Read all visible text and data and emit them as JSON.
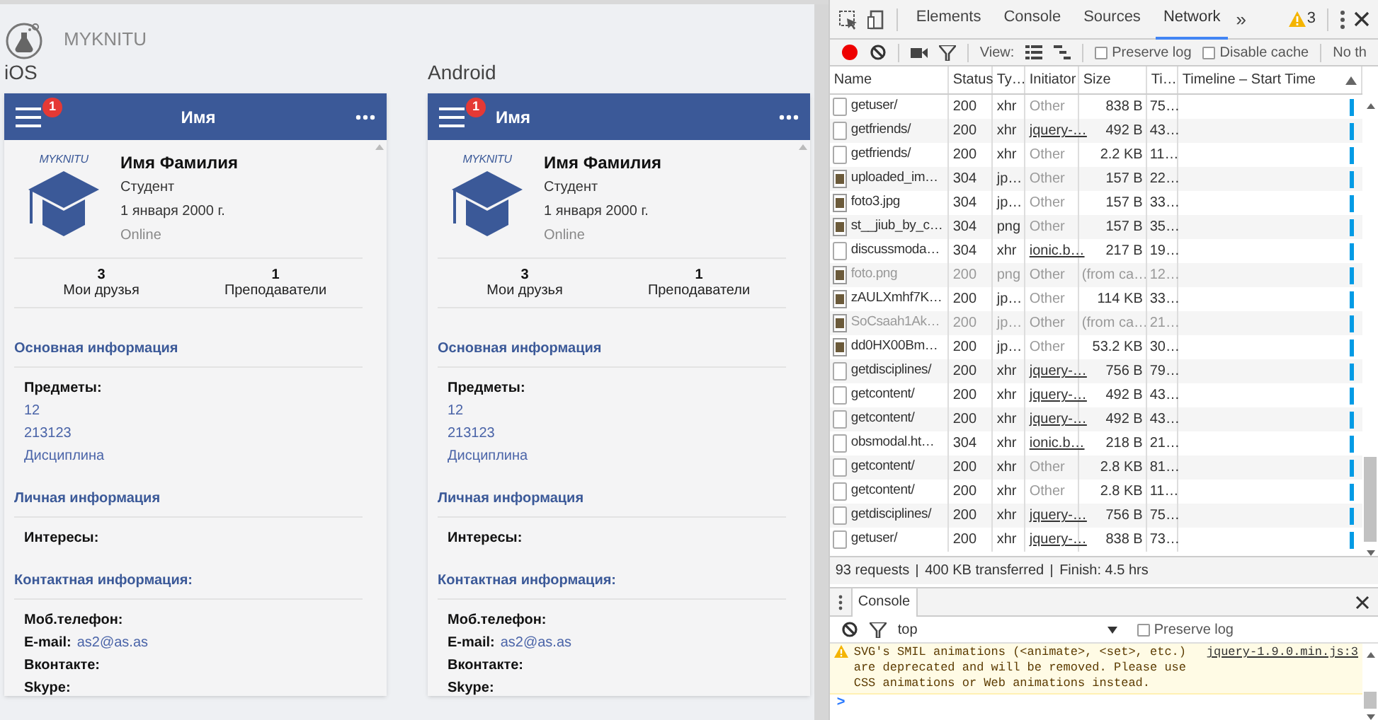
{
  "app": {
    "logo_text": "MYKNITU"
  },
  "previews": [
    {
      "platform": "iOS",
      "kind": "ios",
      "header": {
        "title": "Имя",
        "badge": "1"
      },
      "profile": {
        "logo_text": "MYKNITU",
        "name": "Имя Фамилия",
        "role": "Студент",
        "birthday": "1 января 2000 г.",
        "status": "Online"
      },
      "stats": [
        {
          "value": "3",
          "label": "Мои друзья"
        },
        {
          "value": "1",
          "label": "Преподаватели"
        }
      ],
      "sections": [
        {
          "title": "Основная информация",
          "fields": [
            {
              "label": "Предметы:",
              "items": [
                "12",
                "213123",
                "Дисциплина"
              ]
            }
          ]
        },
        {
          "title": "Личная информация",
          "fields": [
            {
              "label": "Интересы:"
            }
          ]
        },
        {
          "title": "Контактная информация:",
          "fields": [
            {
              "label": "Моб.телефон:"
            },
            {
              "label": "E-mail:",
              "value": "as2@as.as"
            },
            {
              "label": "Вконтакте:"
            },
            {
              "label": "Skype:"
            }
          ]
        }
      ]
    },
    {
      "platform": "Android",
      "kind": "android",
      "header": {
        "title": "Имя",
        "badge": "1"
      },
      "profile": {
        "logo_text": "MYKNITU",
        "name": "Имя Фамилия",
        "role": "Студент",
        "birthday": "1 января 2000 г.",
        "status": "Online"
      },
      "stats": [
        {
          "value": "3",
          "label": "Мои друзья"
        },
        {
          "value": "1",
          "label": "Преподаватели"
        }
      ],
      "sections": [
        {
          "title": "Основная информация",
          "fields": [
            {
              "label": "Предметы:",
              "items": [
                "12",
                "213123",
                "Дисциплина"
              ]
            }
          ]
        },
        {
          "title": "Личная информация",
          "fields": [
            {
              "label": "Интересы:"
            }
          ]
        },
        {
          "title": "Контактная информация:",
          "fields": [
            {
              "label": "Моб.телефон:"
            },
            {
              "label": "E-mail:",
              "value": "as2@as.as"
            },
            {
              "label": "Вконтакте:"
            },
            {
              "label": "Skype:"
            }
          ]
        }
      ]
    }
  ],
  "devtools": {
    "tabs": [
      {
        "label": "Elements",
        "selected": false
      },
      {
        "label": "Console",
        "selected": false
      },
      {
        "label": "Sources",
        "selected": false
      },
      {
        "label": "Network",
        "selected": true
      }
    ],
    "more": "»",
    "warnings": "3",
    "toolbar": {
      "view_label": "View:",
      "options": [
        {
          "label": "Preserve log",
          "checked": false
        },
        {
          "label": "Disable cache",
          "checked": false
        }
      ],
      "throttle": "No th"
    },
    "columns": [
      "Name",
      "Status",
      "Ty…",
      "Initiator",
      "Size",
      "Ti…",
      "Timeline – Start Time"
    ],
    "rows": [
      {
        "name": "getuser/",
        "kind": "doc",
        "status": "200",
        "type": "xhr",
        "initiator": "Other",
        "initiator_link": false,
        "size": "838 B",
        "time": "75…",
        "cached": false
      },
      {
        "name": "getfriends/",
        "kind": "doc",
        "status": "200",
        "type": "xhr",
        "initiator": "jquery-…",
        "initiator_link": true,
        "size": "492 B",
        "time": "43…",
        "cached": false
      },
      {
        "name": "getfriends/",
        "kind": "doc",
        "status": "200",
        "type": "xhr",
        "initiator": "Other",
        "initiator_link": false,
        "size": "2.2 KB",
        "time": "11…",
        "cached": false
      },
      {
        "name": "uploaded_im…",
        "kind": "image",
        "status": "304",
        "type": "jp…",
        "initiator": "Other",
        "initiator_link": false,
        "size": "157 B",
        "time": "22…",
        "cached": false
      },
      {
        "name": "foto3.jpg",
        "kind": "image",
        "status": "304",
        "type": "jp…",
        "initiator": "Other",
        "initiator_link": false,
        "size": "157 B",
        "time": "33…",
        "cached": false
      },
      {
        "name": "st__jiub_by_c…",
        "kind": "image",
        "status": "304",
        "type": "png",
        "initiator": "Other",
        "initiator_link": false,
        "size": "157 B",
        "time": "35…",
        "cached": false
      },
      {
        "name": "discussmoda…",
        "kind": "doc",
        "status": "304",
        "type": "xhr",
        "initiator": "ionic.b…",
        "initiator_link": true,
        "size": "217 B",
        "time": "19…",
        "cached": false
      },
      {
        "name": "foto.png",
        "kind": "image",
        "status": "200",
        "type": "png",
        "initiator": "Other",
        "initiator_link": false,
        "size": "(from ca…",
        "time": "12…",
        "cached": true
      },
      {
        "name": "zAULXmhf7K…",
        "kind": "image",
        "status": "200",
        "type": "jp…",
        "initiator": "Other",
        "initiator_link": false,
        "size": "114 KB",
        "time": "33…",
        "cached": false
      },
      {
        "name": "SoCsaah1Ak…",
        "kind": "image",
        "status": "200",
        "type": "jp…",
        "initiator": "Other",
        "initiator_link": false,
        "size": "(from ca…",
        "time": "21…",
        "cached": true
      },
      {
        "name": "dd0HX00Bm…",
        "kind": "image",
        "status": "200",
        "type": "jp…",
        "initiator": "Other",
        "initiator_link": false,
        "size": "53.2 KB",
        "time": "30…",
        "cached": false
      },
      {
        "name": "getdisciplines/",
        "kind": "doc",
        "status": "200",
        "type": "xhr",
        "initiator": "jquery-…",
        "initiator_link": true,
        "size": "756 B",
        "time": "79…",
        "cached": false
      },
      {
        "name": "getcontent/",
        "kind": "doc",
        "status": "200",
        "type": "xhr",
        "initiator": "jquery-…",
        "initiator_link": true,
        "size": "492 B",
        "time": "43…",
        "cached": false
      },
      {
        "name": "getcontent/",
        "kind": "doc",
        "status": "200",
        "type": "xhr",
        "initiator": "jquery-…",
        "initiator_link": true,
        "size": "492 B",
        "time": "43…",
        "cached": false
      },
      {
        "name": "obsmodal.ht…",
        "kind": "doc",
        "status": "304",
        "type": "xhr",
        "initiator": "ionic.b…",
        "initiator_link": true,
        "size": "218 B",
        "time": "21…",
        "cached": false
      },
      {
        "name": "getcontent/",
        "kind": "doc",
        "status": "200",
        "type": "xhr",
        "initiator": "Other",
        "initiator_link": false,
        "size": "2.8 KB",
        "time": "81…",
        "cached": false
      },
      {
        "name": "getcontent/",
        "kind": "doc",
        "status": "200",
        "type": "xhr",
        "initiator": "Other",
        "initiator_link": false,
        "size": "2.8 KB",
        "time": "11…",
        "cached": false
      },
      {
        "name": "getdisciplines/",
        "kind": "doc",
        "status": "200",
        "type": "xhr",
        "initiator": "jquery-…",
        "initiator_link": true,
        "size": "756 B",
        "time": "75…",
        "cached": false
      },
      {
        "name": "getuser/",
        "kind": "doc",
        "status": "200",
        "type": "xhr",
        "initiator": "jquery-…",
        "initiator_link": true,
        "size": "838 B",
        "time": "73…",
        "cached": false
      }
    ],
    "summary": [
      "93 requests",
      "400 KB transferred",
      "Finish: 4.5 hrs"
    ],
    "drawer": {
      "tab": "Console",
      "context": "top",
      "preserve_log": {
        "label": "Preserve log",
        "checked": false
      },
      "messages": [
        {
          "kind": "warning",
          "text": "SVG's SMIL animations (<animate>, <set>, etc.) are deprecated and will be removed. Please use CSS animations or Web animations instead.",
          "source": "jquery-1.9.0.min.js:3"
        }
      ],
      "prompt": ">"
    }
  }
}
